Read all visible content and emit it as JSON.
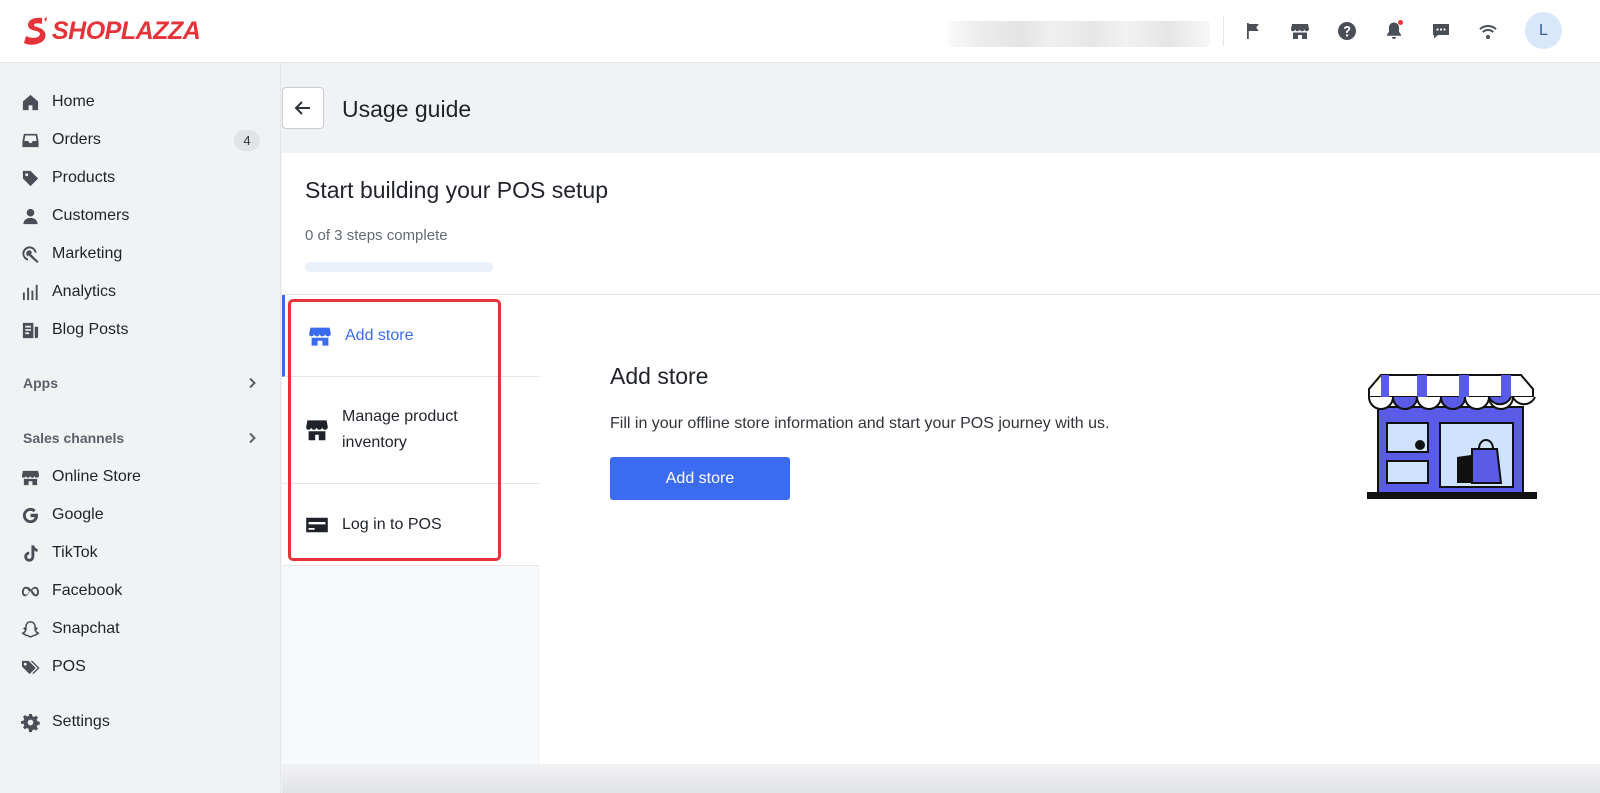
{
  "app": {
    "brand": "SHOPLAZZA",
    "accent": "#3b6bf0",
    "brand_color": "#e5333a"
  },
  "topbar": {
    "icons": [
      "flag-icon",
      "storefront-icon",
      "help-icon",
      "bell-icon",
      "chat-icon",
      "wifi-icon"
    ],
    "avatar_initial": "L"
  },
  "sidebar": {
    "items": [
      {
        "label": "Home",
        "icon": "home-icon"
      },
      {
        "label": "Orders",
        "icon": "inbox-icon",
        "badge": "4"
      },
      {
        "label": "Products",
        "icon": "tag-icon"
      },
      {
        "label": "Customers",
        "icon": "person-icon"
      },
      {
        "label": "Marketing",
        "icon": "marketing-icon"
      },
      {
        "label": "Analytics",
        "icon": "bar-chart-icon"
      },
      {
        "label": "Blog Posts",
        "icon": "document-icon"
      }
    ],
    "apps_label": "Apps",
    "sales_channels_label": "Sales channels",
    "channels": [
      {
        "label": "Online Store",
        "icon": "storefront-icon"
      },
      {
        "label": "Google",
        "icon": "google-icon"
      },
      {
        "label": "TikTok",
        "icon": "tiktok-icon"
      },
      {
        "label": "Facebook",
        "icon": "meta-icon"
      },
      {
        "label": "Snapchat",
        "icon": "snapchat-icon"
      },
      {
        "label": "POS",
        "icon": "tags-icon"
      }
    ],
    "settings_label": "Settings"
  },
  "page": {
    "title": "Usage guide",
    "card_title": "Start building your POS setup",
    "progress_text": "0 of 3 steps complete",
    "progress_fraction": 0,
    "steps": [
      {
        "label": "Add store",
        "icon": "storefront-icon",
        "active": true
      },
      {
        "label": "Manage product inventory",
        "icon": "store-inventory-icon",
        "active": false
      },
      {
        "label": "Log in to POS",
        "icon": "card-icon",
        "active": false
      }
    ],
    "detail": {
      "title": "Add store",
      "description": "Fill in your offline store information and start your POS journey with us.",
      "button_label": "Add store"
    }
  }
}
